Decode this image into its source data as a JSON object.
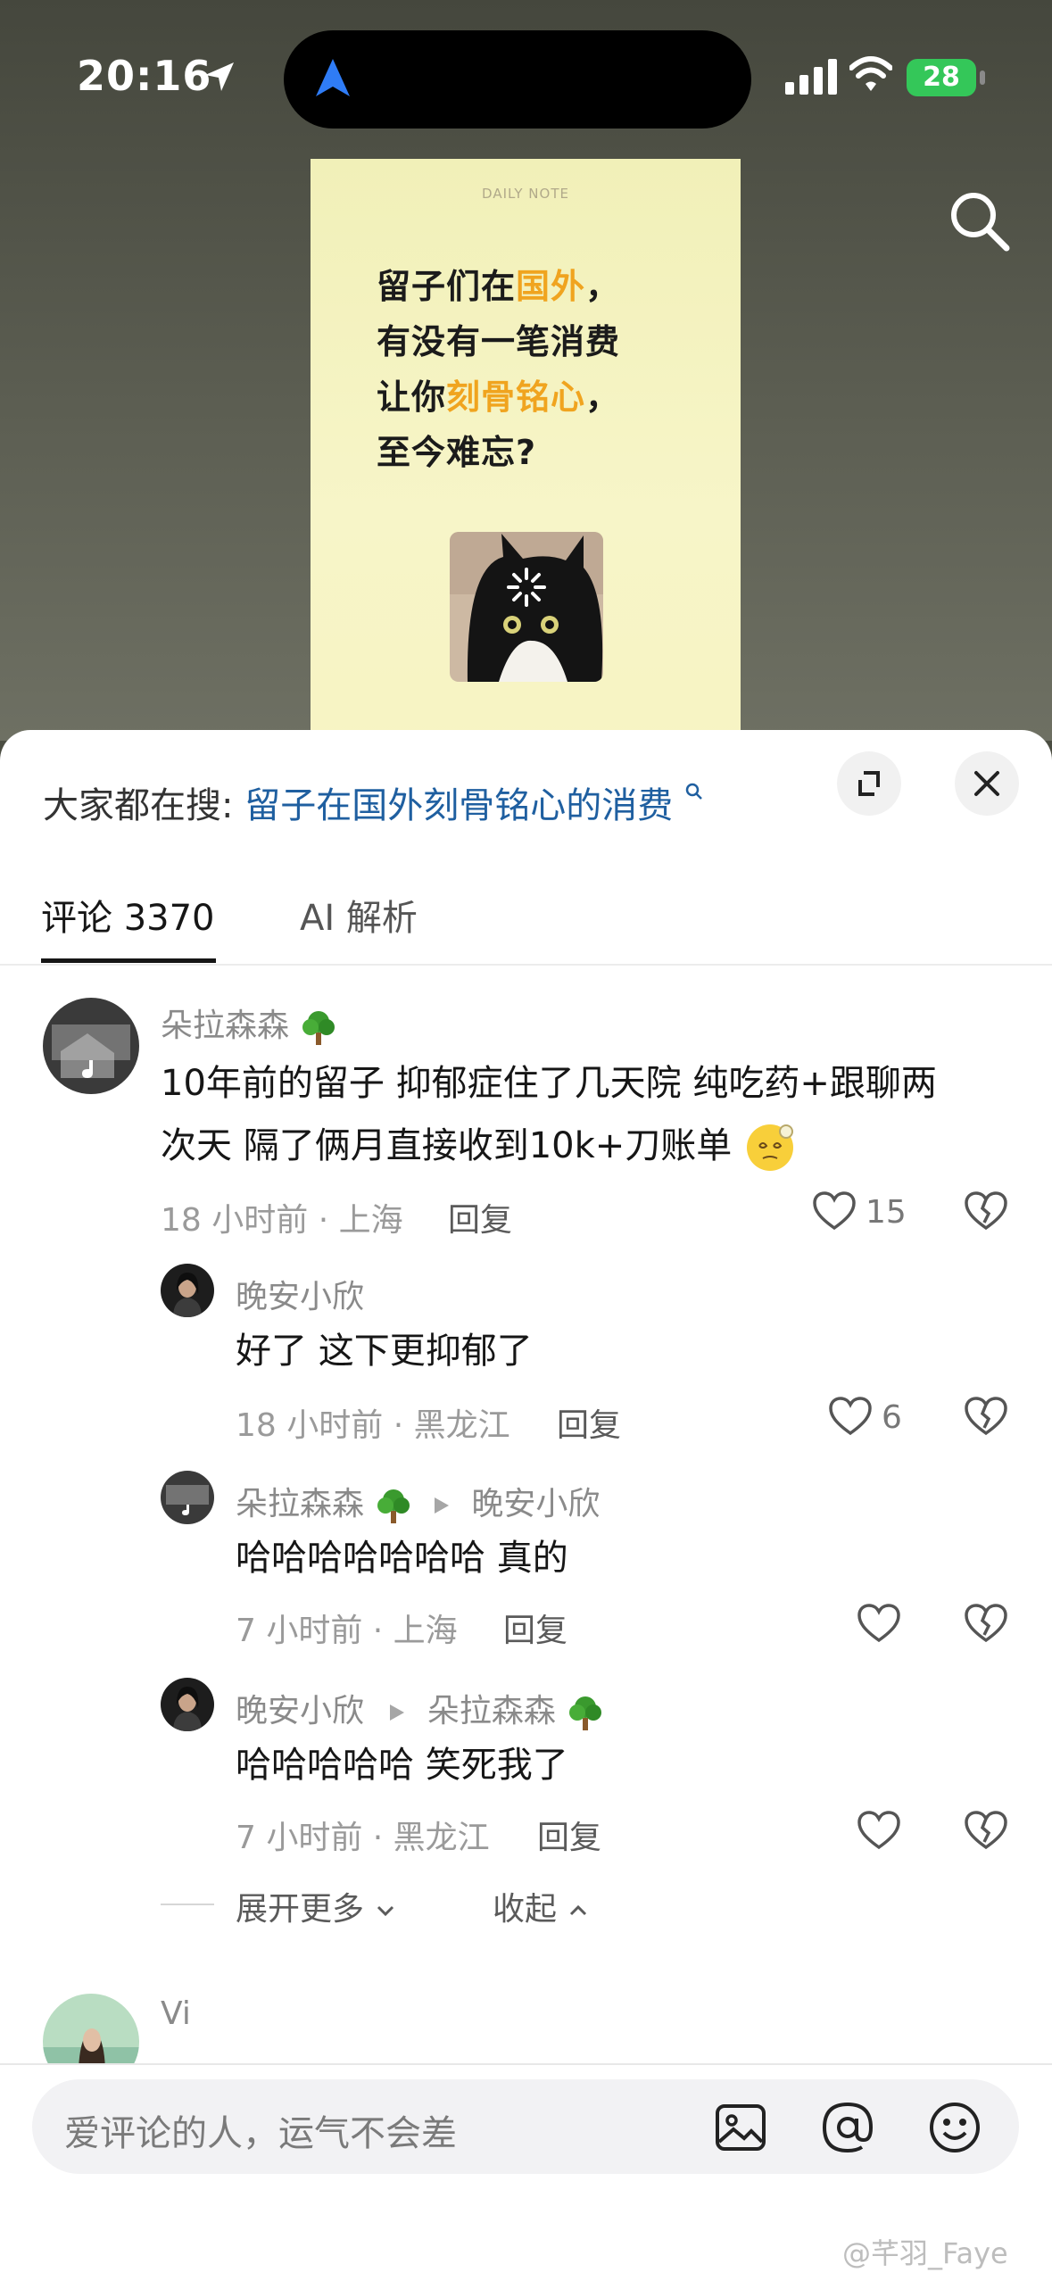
{
  "status_bar": {
    "time": "20:16",
    "battery": "28"
  },
  "video": {
    "note_tag": "DAILY NOTE",
    "lines": [
      {
        "pre": "留子们在",
        "hl": "国外",
        "post": "，"
      },
      {
        "pre": "有没有一笔消费",
        "hl": "",
        "post": ""
      },
      {
        "pre": "让你",
        "hl": "刻骨铭心",
        "post": "，"
      },
      {
        "pre": "至今难忘?",
        "hl": "",
        "post": ""
      }
    ]
  },
  "hot_search": {
    "prefix": "大家都在搜:",
    "query": "留子在国外刻骨铭心的消费"
  },
  "tabs": {
    "comments": "评论 3370",
    "ai": "AI 解析"
  },
  "comments": [
    {
      "user": "朵拉森森",
      "lines": [
        "10年前的留子 抑郁症住了几天院 纯吃药+跟聊两",
        "次天 隔了俩月直接收到10k+刀账单"
      ],
      "meta": "18 小时前 · 上海",
      "reply": "回复",
      "likes": "15"
    }
  ],
  "replies": [
    {
      "user": "晚安小欣",
      "to": "",
      "text": "好了 这下更抑郁了",
      "meta": "18 小时前 · 黑龙江",
      "reply": "回复",
      "likes": "6"
    },
    {
      "user": "朵拉森森",
      "to": "晚安小欣",
      "text": "哈哈哈哈哈哈哈 真的",
      "meta": "7 小时前 · 上海",
      "reply": "回复",
      "likes": ""
    },
    {
      "user": "晚安小欣",
      "to": "朵拉森森",
      "text": "哈哈哈哈哈 笑死我了",
      "meta": "7 小时前 · 黑龙江",
      "reply": "回复",
      "likes": ""
    }
  ],
  "expand_more": "展开更多",
  "collapse": "收起",
  "next_comment_user": "Vi",
  "input": {
    "placeholder": "爱评论的人，运气不会差"
  },
  "watermark": "@芊羽_Faye",
  "colors": {
    "highlight": "#f0a41f",
    "link": "#1f5fa0",
    "battery": "#34c759"
  }
}
